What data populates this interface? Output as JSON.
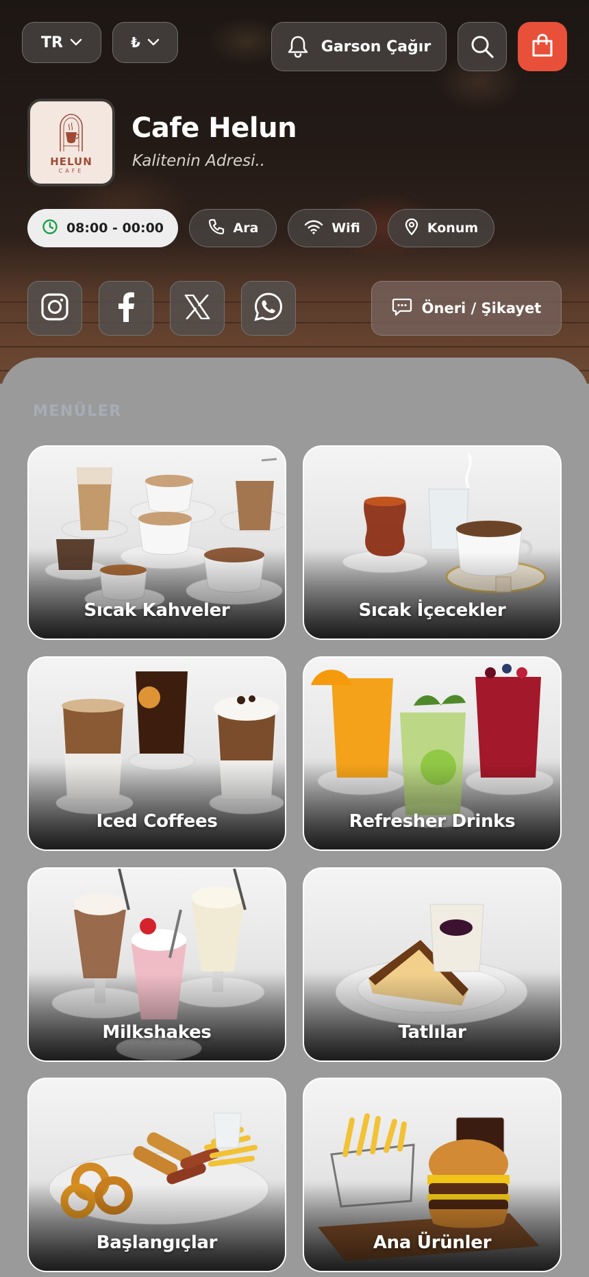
{
  "header": {
    "language": "TR",
    "currency": "₺",
    "waiter_label": "Garson Çağır",
    "cafe_name": "Cafe Helun",
    "tagline": "Kalitenin Adresi..",
    "logo_text": "HELUN",
    "logo_subtext": "CAFE",
    "hours": "08:00 - 00:00",
    "call_label": "Ara",
    "wifi_label": "Wifi",
    "location_label": "Konum",
    "feedback_label": "Öneri / Şikayet"
  },
  "colors": {
    "accent": "#e9503a",
    "open_hours_icon": "#1aa04a",
    "panel_bg": "#9a9a9a"
  },
  "icons": {
    "language_chevron": "chevron-down-icon",
    "currency_chevron": "chevron-down-icon",
    "waiter": "bell-icon",
    "search": "search-icon",
    "cart": "shopping-bag-icon",
    "hours": "clock-icon",
    "call": "phone-icon",
    "wifi": "wifi-icon",
    "location": "map-pin-icon",
    "instagram": "instagram-icon",
    "facebook": "facebook-icon",
    "x": "x-icon",
    "whatsapp": "whatsapp-icon",
    "feedback": "chat-icon"
  },
  "menu": {
    "title": "MENÜLER",
    "categories": [
      {
        "label": "Sıcak Kahveler"
      },
      {
        "label": "Sıcak İçecekler"
      },
      {
        "label": "Iced Coffees"
      },
      {
        "label": "Refresher Drinks"
      },
      {
        "label": "Milkshakes"
      },
      {
        "label": "Tatlılar"
      },
      {
        "label": "Başlangıçlar"
      },
      {
        "label": "Ana Ürünler"
      }
    ]
  }
}
